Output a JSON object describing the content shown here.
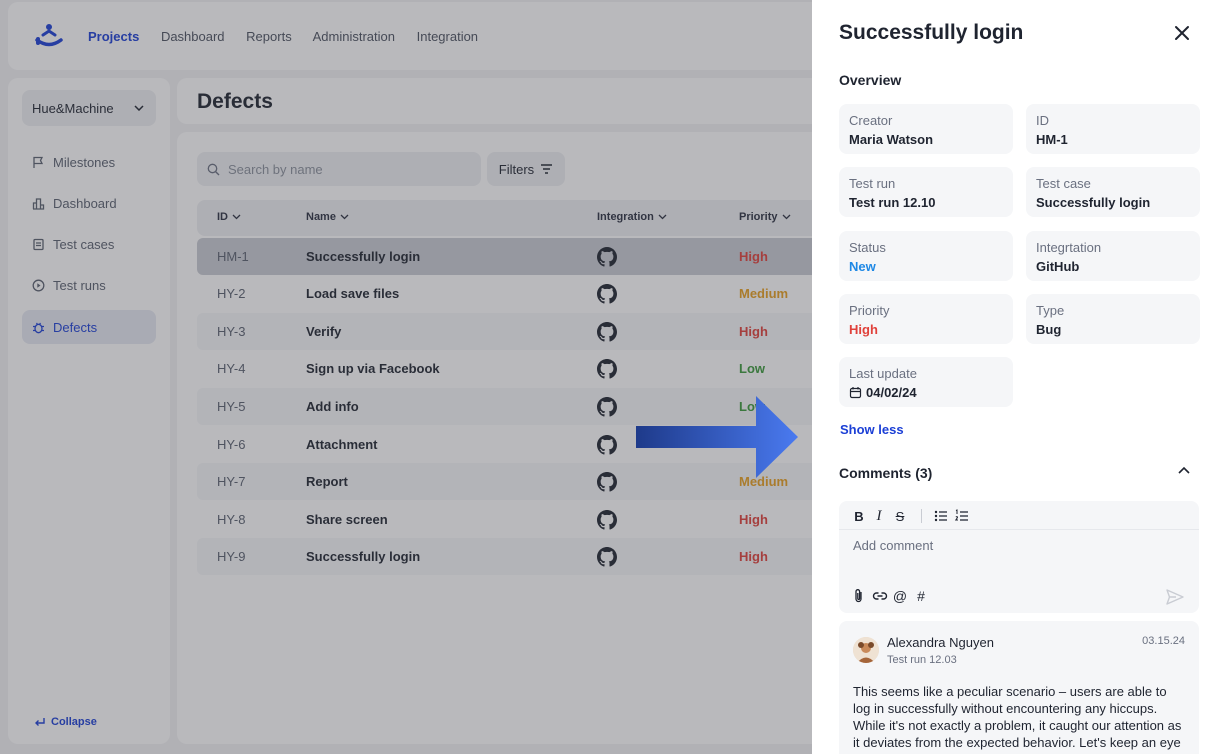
{
  "nav": {
    "items": [
      {
        "label": "Projects",
        "active": true
      },
      {
        "label": "Dashboard",
        "active": false
      },
      {
        "label": "Reports",
        "active": false
      },
      {
        "label": "Administration",
        "active": false
      },
      {
        "label": "Integration",
        "active": false
      }
    ]
  },
  "sidebar": {
    "workspace": "Hue&Machine",
    "items": [
      {
        "label": "Milestones",
        "icon": "flag-icon"
      },
      {
        "label": "Dashboard",
        "icon": "chart-icon"
      },
      {
        "label": "Test cases",
        "icon": "document-icon"
      },
      {
        "label": "Test runs",
        "icon": "play-icon"
      },
      {
        "label": "Defects",
        "icon": "bug-icon",
        "active": true
      }
    ],
    "collapse_label": "Collapse"
  },
  "page": {
    "title": "Defects",
    "search_placeholder": "Search by name",
    "filters_label": "Filters"
  },
  "table": {
    "headers": {
      "id": "ID",
      "name": "Name",
      "integration": "Integration",
      "priority": "Priority"
    },
    "rows": [
      {
        "id": "HM-1",
        "name": "Successfully login",
        "integration": "github-icon",
        "priority": "High"
      },
      {
        "id": "HY-2",
        "name": "Load save files",
        "integration": "github-icon",
        "priority": "Medium"
      },
      {
        "id": "HY-3",
        "name": "Verify",
        "integration": "github-icon",
        "priority": "High"
      },
      {
        "id": "HY-4",
        "name": "Sign up via Facebook",
        "integration": "github-icon",
        "priority": "Low"
      },
      {
        "id": "HY-5",
        "name": "Add info",
        "integration": "github-icon",
        "priority": "Low"
      },
      {
        "id": "HY-6",
        "name": "Attachment",
        "integration": "github-icon",
        "priority": ""
      },
      {
        "id": "HY-7",
        "name": "Report",
        "integration": "github-icon",
        "priority": "Medium"
      },
      {
        "id": "HY-8",
        "name": "Share screen",
        "integration": "github-icon",
        "priority": "High"
      },
      {
        "id": "HY-9",
        "name": "Successfully login",
        "integration": "github-icon",
        "priority": "High"
      }
    ]
  },
  "priority_colors": {
    "High": "#e0413b",
    "Medium": "#e8a020",
    "Low": "#3a9a3a"
  },
  "panel": {
    "title": "Successfully login",
    "overview_label": "Overview",
    "fields": {
      "creator": {
        "label": "Creator",
        "value": "Maria Watson"
      },
      "id": {
        "label": "ID",
        "value": "HM-1"
      },
      "test_run": {
        "label": "Test run",
        "value": "Test run 12.10"
      },
      "test_case": {
        "label": "Test case",
        "value": "Successfully login"
      },
      "status": {
        "label": "Status",
        "value": "New",
        "color": "#1e88e5"
      },
      "integration": {
        "label": "Integrtation",
        "value": "GitHub"
      },
      "priority": {
        "label": "Priority",
        "value": "High",
        "color": "#e0413b"
      },
      "type": {
        "label": "Type",
        "value": "Bug"
      },
      "last_update": {
        "label": "Last update",
        "value": "04/02/24"
      }
    },
    "show_less": "Show less",
    "comments_label": "Comments (3)",
    "editor": {
      "placeholder": "Add comment",
      "toolbar": [
        "bold-icon",
        "italic-icon",
        "strikethrough-icon",
        "bullet-list-icon",
        "numbered-list-icon"
      ],
      "bottom": [
        "attach-icon",
        "link-icon",
        "mention-icon",
        "hashtag-icon"
      ]
    },
    "comment": {
      "author": "Alexandra Nguyen",
      "subtitle": "Test run 12.03",
      "date": "03.15.24",
      "text": "This seems like a peculiar scenario – users are able to log in successfully without encountering any hiccups. While it's not exactly a problem, it caught our attention as it deviates from the expected behavior. Let's keep an eye on"
    }
  }
}
